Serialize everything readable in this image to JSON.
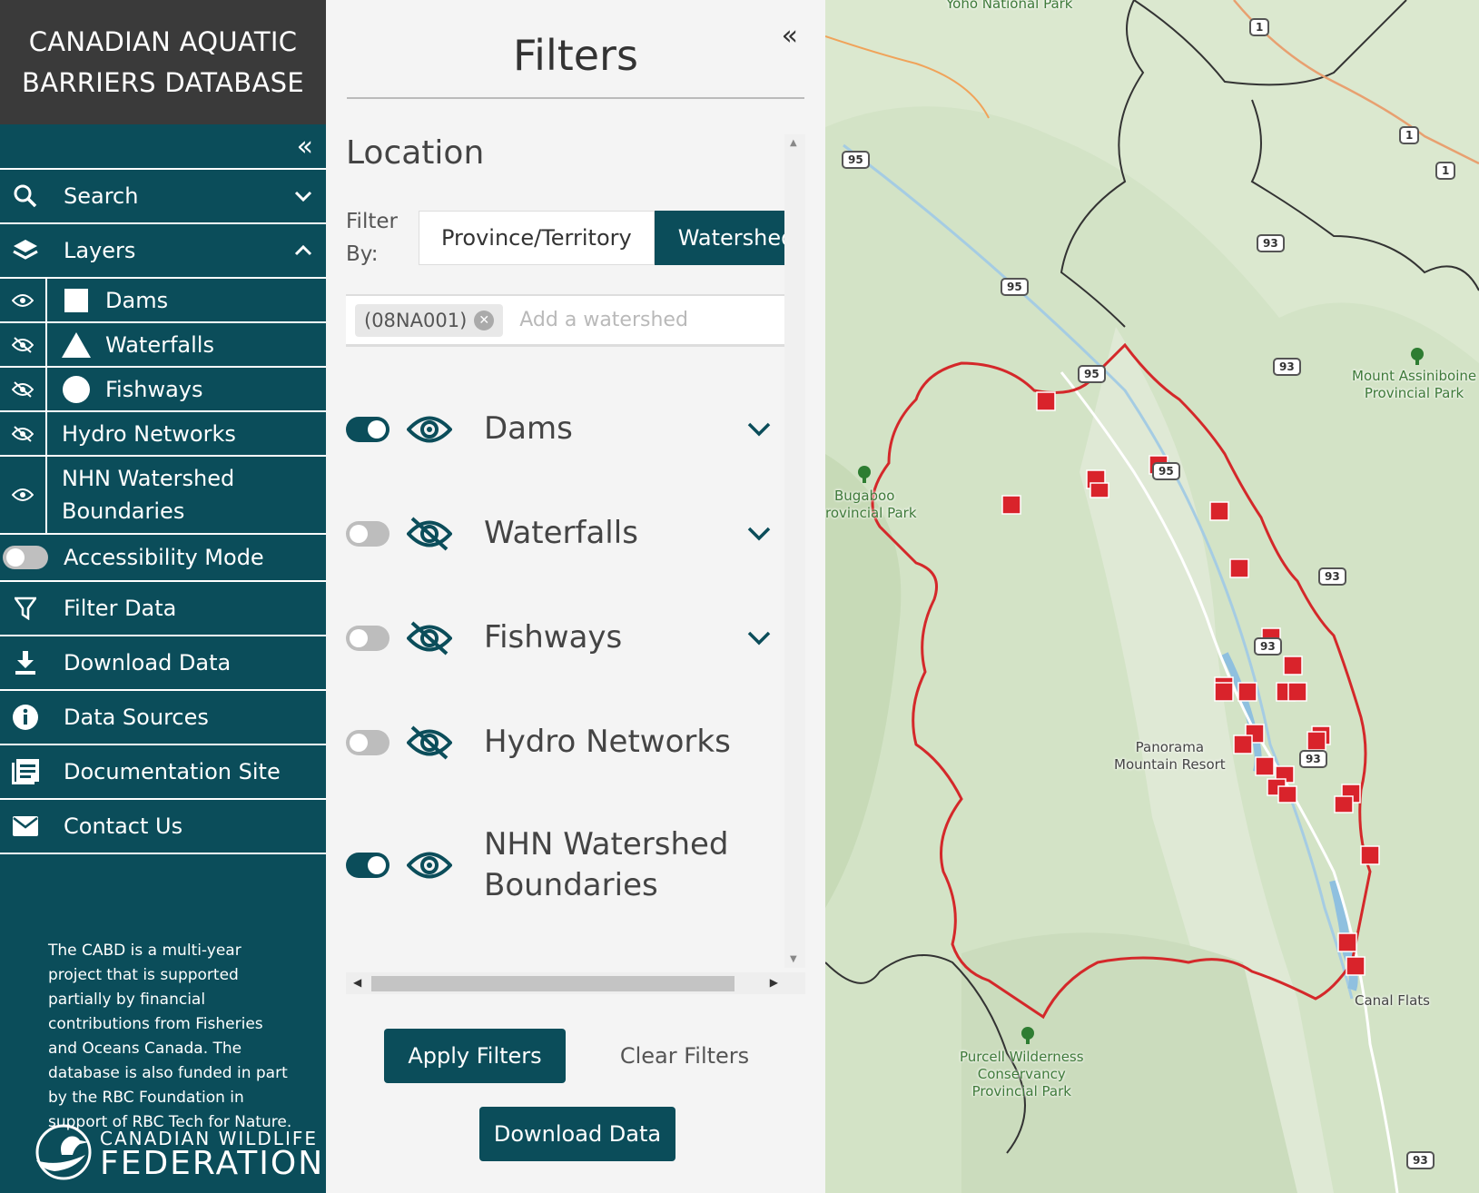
{
  "sidebar": {
    "brand_line1": "CANADIAN AQUATIC",
    "brand_line2": "BARRIERS DATABASE",
    "nav": {
      "search": "Search",
      "layers": "Layers",
      "accessibility": "Accessibility Mode",
      "filter": "Filter Data",
      "download": "Download Data",
      "sources": "Data Sources",
      "docs": "Documentation Site",
      "contact": "Contact Us"
    },
    "layers": {
      "dams": "Dams",
      "waterfalls": "Waterfalls",
      "fishways": "Fishways",
      "hydro": "Hydro Networks",
      "nhn_line1": "NHN Watershed",
      "nhn_line2": "Boundaries"
    },
    "about": "The CABD is a multi-year project that is supported partially by financial contributions from Fisheries and Oceans Canada. The database is also funded in part by the RBC Foundation in support of RBC Tech for Nature.",
    "logo_line1": "CANADIAN WILDLIFE",
    "logo_line2": "FEDERATION"
  },
  "filters": {
    "title": "Filters",
    "location_title": "Location",
    "filter_by_line1": "Filter",
    "filter_by_line2": "By:",
    "seg_province": "Province/Territory",
    "seg_watershed": "Watershed",
    "tag": "(08NA001)",
    "tag_placeholder": "Add a watershed",
    "rows": {
      "dams": "Dams",
      "waterfalls": "Waterfalls",
      "fishways": "Fishways",
      "hydro": "Hydro Networks",
      "nhn_line1": "NHN Watershed",
      "nhn_line2": "Boundaries"
    },
    "apply": "Apply Filters",
    "clear": "Clear Filters",
    "download": "Download Data"
  },
  "map": {
    "labels": {
      "yoho": "Yoho National Park",
      "assiniboine_1": "Mount Assiniboine",
      "assiniboine_2": "Provincial Park",
      "bugaboo_1": "Bugaboo",
      "bugaboo_2": "rovincial Park",
      "panorama_1": "Panorama",
      "panorama_2": "Mountain Resort",
      "canal": "Canal Flats",
      "purcell_1": "Purcell Wilderness",
      "purcell_2": "Conservancy",
      "purcell_3": "Provincial Park"
    },
    "shields": [
      "1",
      "1",
      "1",
      "95",
      "95",
      "95",
      "95",
      "93",
      "93",
      "93",
      "93",
      "93",
      "93"
    ],
    "colors": {
      "boundary": "#d4282a",
      "dam": "#d9232b",
      "water": "#a5cce3",
      "terrain": "#cfe0c2"
    }
  },
  "colors": {
    "primary": "#0b4d5a",
    "header": "#3a3a3a"
  }
}
